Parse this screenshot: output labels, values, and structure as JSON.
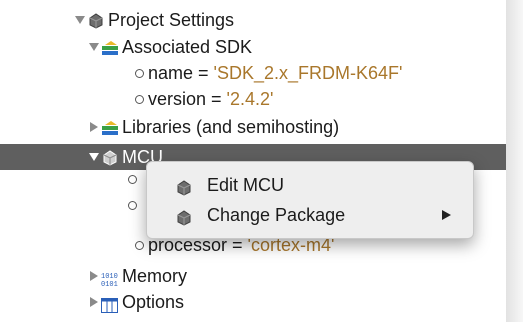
{
  "tree": {
    "project_settings": {
      "label": "Project Settings",
      "icon": "gear-icon"
    },
    "associated_sdk": {
      "label": "Associated SDK",
      "icon": "sdk-icon"
    },
    "sdk_name": {
      "key": "name = ",
      "value": "'SDK_2.x_FRDM-K64F'"
    },
    "sdk_version": {
      "key": "version = ",
      "value": "'2.4.2'"
    },
    "libraries": {
      "label": "Libraries (and semihosting)",
      "icon": "sdk-icon"
    },
    "mcu": {
      "label": "MCU",
      "icon": "gear-icon"
    },
    "processor": {
      "key": "processor = ",
      "value": "'cortex-m4'"
    },
    "memory": {
      "label": "Memory",
      "icon": "binary-icon"
    },
    "options": {
      "label": "Options",
      "icon": "table-icon"
    }
  },
  "context_menu": {
    "items": [
      {
        "label": "Edit MCU",
        "icon": "gear-icon"
      },
      {
        "label": "Change Package",
        "icon": "gear-icon",
        "submenu": true
      }
    ]
  },
  "colors": {
    "selection": "#5f5f5f",
    "string_value": "#a9772b"
  }
}
